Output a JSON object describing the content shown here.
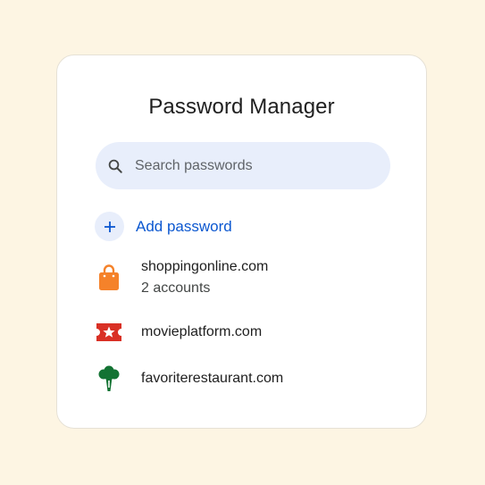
{
  "header": {
    "title": "Password Manager"
  },
  "search": {
    "placeholder": "Search passwords",
    "icon": "search-icon"
  },
  "add": {
    "label": "Add password",
    "icon": "plus-icon"
  },
  "colors": {
    "accent": "#0b57d0",
    "search_bg": "#e8eefb",
    "page_bg": "#fdf5e3",
    "shopping_icon": "#f5822a",
    "movie_icon": "#d93025",
    "restaurant_icon": "#137333"
  },
  "passwords": [
    {
      "site": "shoppingonline.com",
      "sub": "2 accounts",
      "icon": "shopping-bag-icon"
    },
    {
      "site": "movieplatform.com",
      "icon": "ticket-star-icon"
    },
    {
      "site": "favoriterestaurant.com",
      "icon": "broccoli-icon"
    }
  ]
}
